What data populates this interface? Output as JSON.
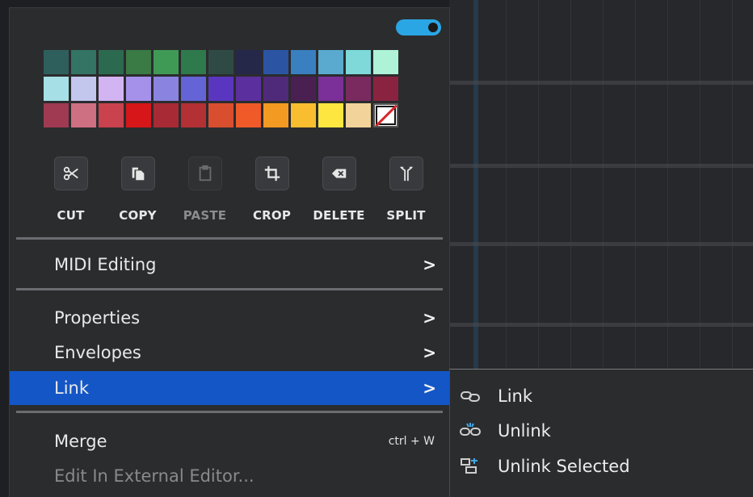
{
  "palette": [
    [
      "#2e5f5d",
      "#347465",
      "#2c6a4f",
      "#3a7a44",
      "#3f9a55",
      "#2e7a4c",
      "#2f4a45",
      "#26284a",
      "#2b55a3",
      "#3a7fc0",
      "#5aa9cf",
      "#7fd9d9",
      "#aef2d8"
    ],
    [
      "#a6e0e6",
      "#c3c7ee",
      "#d3b4f2",
      "#a590ea",
      "#8a84e0",
      "#6464d6",
      "#5a36c0",
      "#5c2f9e",
      "#4f2a7a",
      "#4a1f52",
      "#7b2f99",
      "#7a2a5e",
      "#8a2340"
    ],
    [
      "#9f3a52",
      "#cf6f82",
      "#c9424d",
      "#d61618",
      "#a82a35",
      "#b33035",
      "#d94e2f",
      "#ef5a28",
      "#f39a22",
      "#f8be2f",
      "#fde640",
      "#f2d49a",
      "none"
    ]
  ],
  "actions": [
    {
      "label": "CUT",
      "icon": "scissors-icon",
      "enabled": true
    },
    {
      "label": "COPY",
      "icon": "copy-icon",
      "enabled": true
    },
    {
      "label": "PASTE",
      "icon": "clipboard-icon",
      "enabled": false
    },
    {
      "label": "CROP",
      "icon": "crop-icon",
      "enabled": true
    },
    {
      "label": "DELETE",
      "icon": "delete-key-icon",
      "enabled": true
    },
    {
      "label": "SPLIT",
      "icon": "split-arrows-icon",
      "enabled": true
    }
  ],
  "menu": {
    "midi_editing": "MIDI Editing",
    "properties": "Properties",
    "envelopes": "Envelopes",
    "link": "Link",
    "merge": "Merge",
    "merge_shortcut": "ctrl + W",
    "edit_external": "Edit In External Editor..."
  },
  "submenu": {
    "link": "Link",
    "unlink": "Unlink",
    "unlink_selected": "Unlink Selected"
  },
  "colors": {
    "accent_toggle": "#2aa6e5",
    "highlight": "#1456c6",
    "menu_bg": "#2b2c2e"
  }
}
